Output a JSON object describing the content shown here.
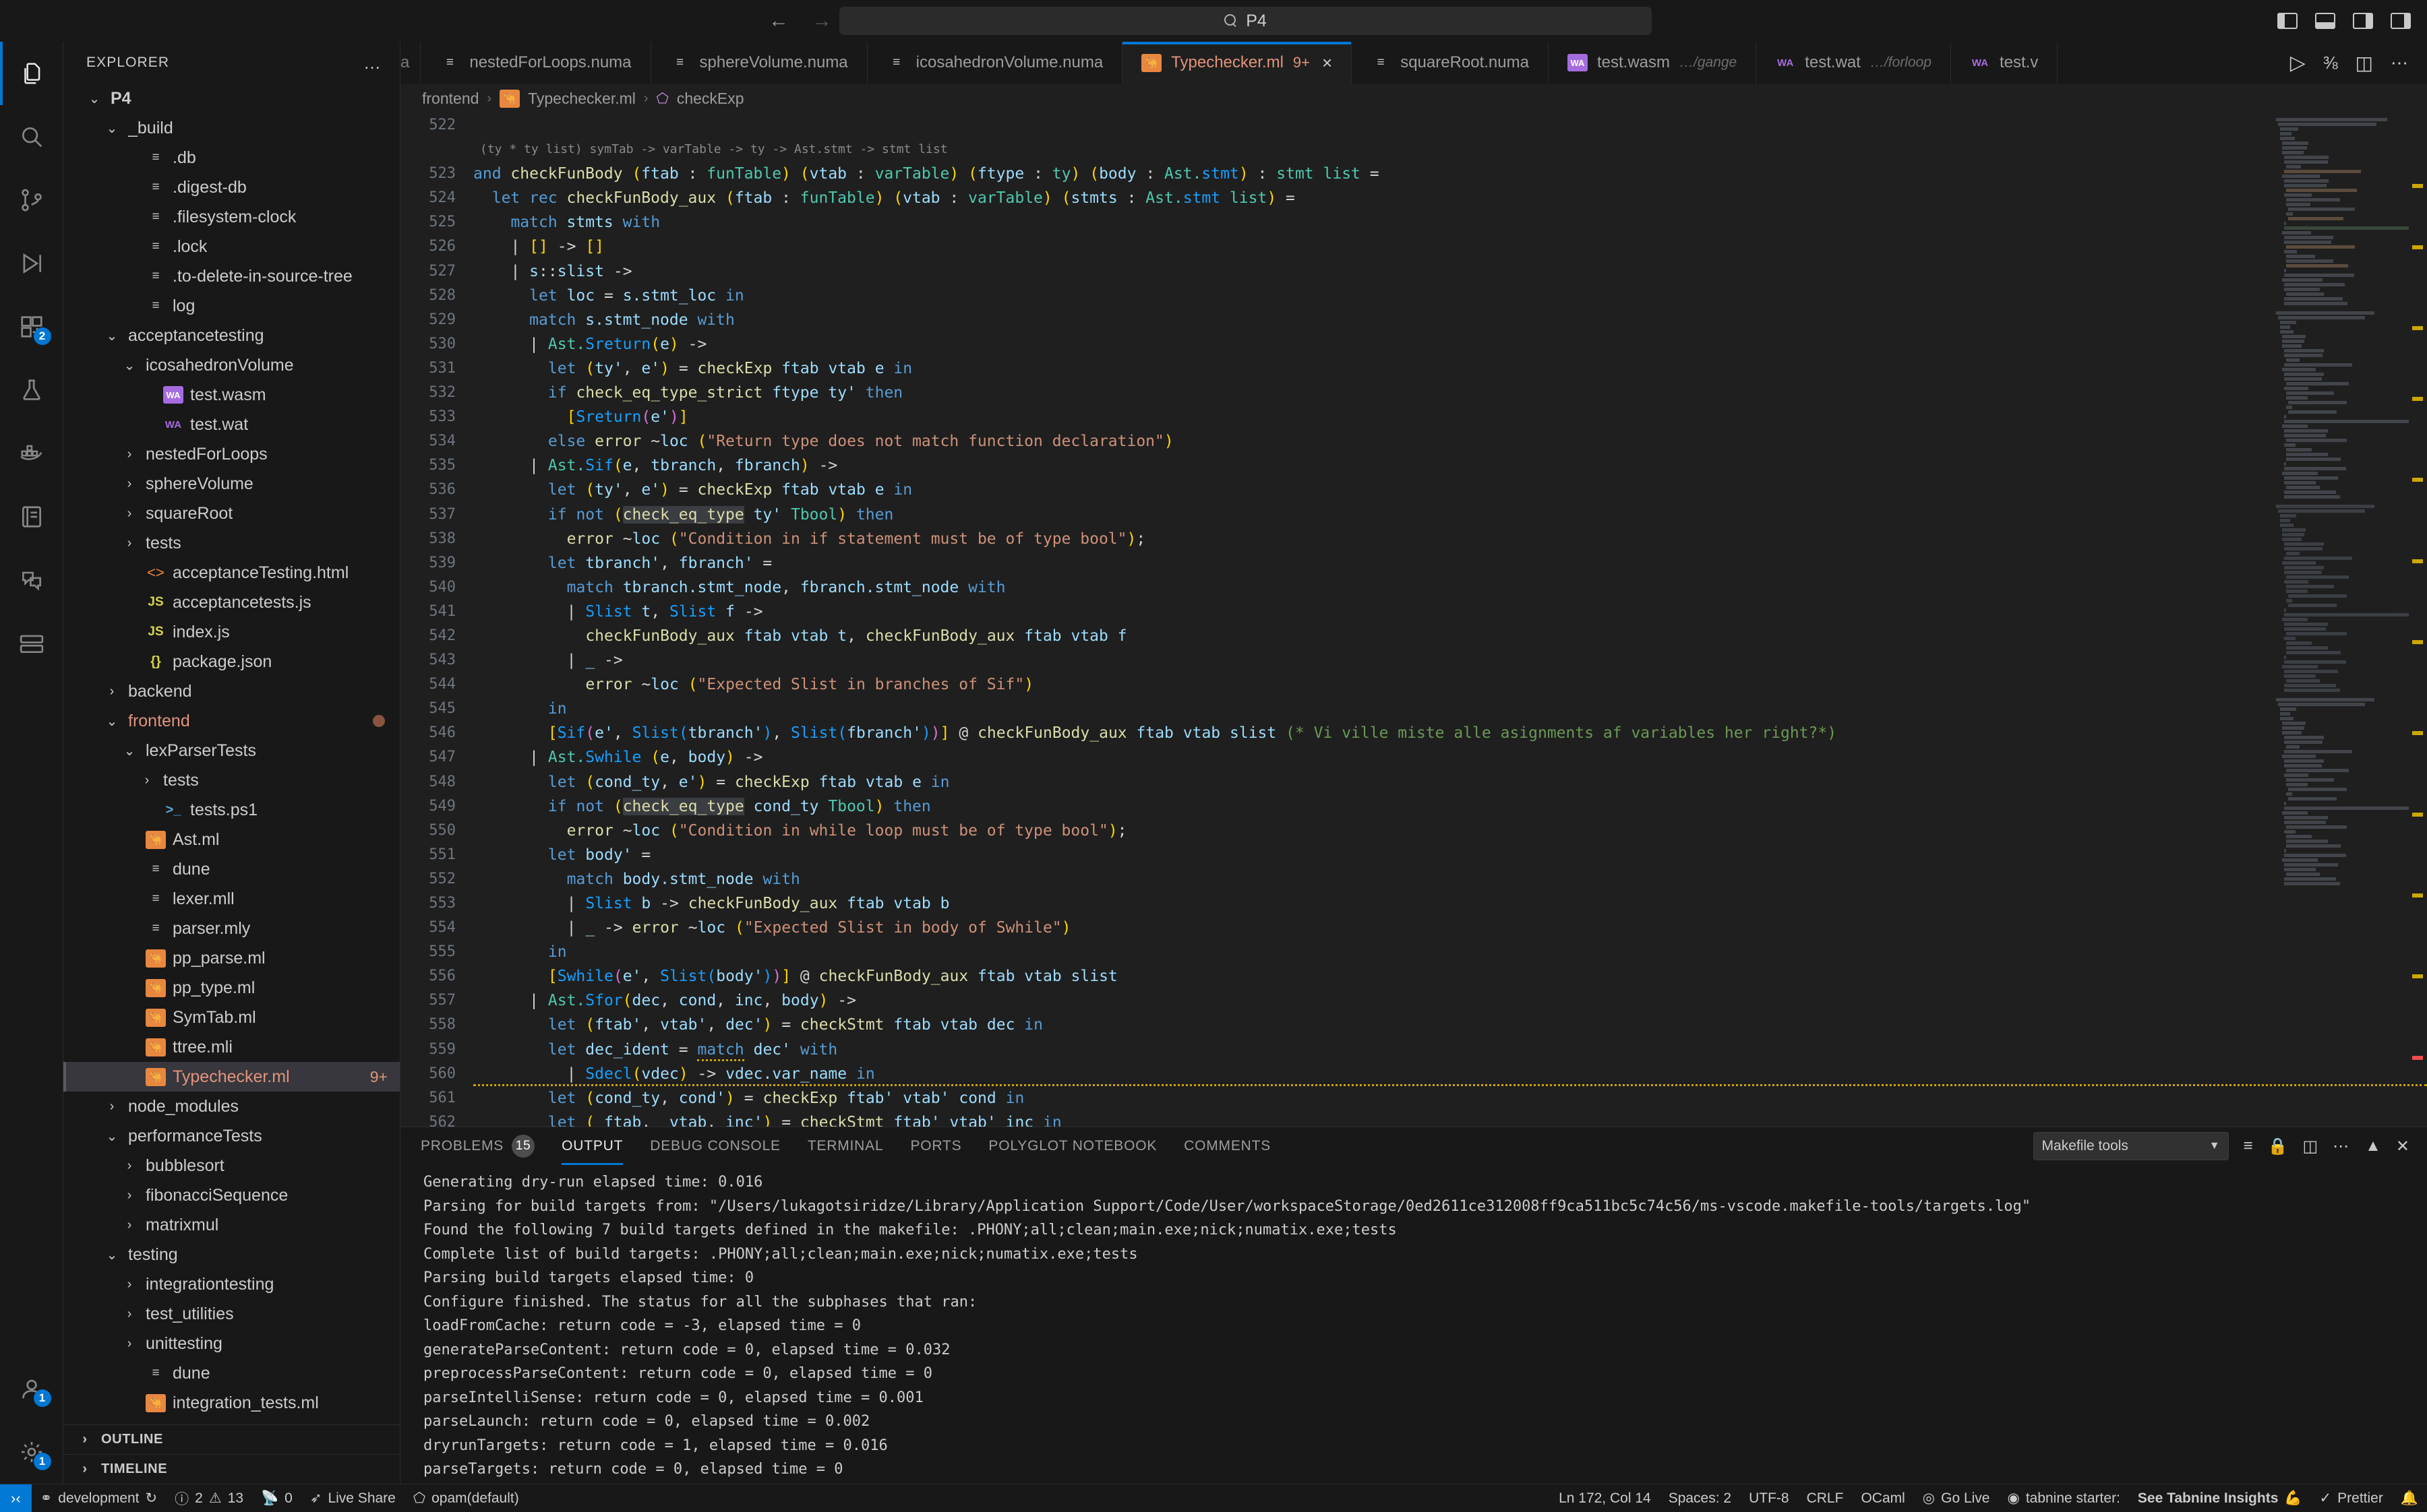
{
  "titlebar": {
    "search_text": "P4",
    "search_icon": "search-icon",
    "back_icon": "back-arrow-icon",
    "forward_icon": "forward-arrow-icon",
    "layout_left_icon": "toggle-primary-sidebar-icon",
    "layout_bottom_icon": "toggle-panel-icon",
    "layout_right_icon": "toggle-secondary-sidebar-icon",
    "layout_custom_icon": "customize-layout-icon"
  },
  "activitybar": {
    "items": [
      {
        "name": "explorer",
        "icon": "files-icon",
        "badge": "",
        "active": true
      },
      {
        "name": "search",
        "icon": "search-icon",
        "badge": "",
        "active": false
      },
      {
        "name": "source-control",
        "icon": "source-control-icon",
        "badge": "",
        "active": false
      },
      {
        "name": "run-and-debug",
        "icon": "run-debug-icon",
        "badge": "",
        "active": false
      },
      {
        "name": "extensions",
        "icon": "extensions-icon",
        "badge": "2",
        "active": false
      },
      {
        "name": "testing",
        "icon": "beaker-icon",
        "badge": "",
        "active": false
      },
      {
        "name": "docker",
        "icon": "docker-icon",
        "badge": "",
        "active": false
      },
      {
        "name": "polyglot-notebook",
        "icon": "notebook-icon",
        "badge": "",
        "active": false
      },
      {
        "name": "live-share",
        "icon": "live-share-icon",
        "badge": "",
        "active": false
      },
      {
        "name": "remote-explorer",
        "icon": "remote-explorer-icon",
        "badge": "",
        "active": false
      }
    ],
    "bottom": [
      {
        "name": "accounts",
        "icon": "account-icon",
        "badge": "1"
      },
      {
        "name": "settings",
        "icon": "gear-icon",
        "badge": "1"
      }
    ]
  },
  "sidebar": {
    "title": "EXPLORER",
    "more_actions": "…",
    "tree": [
      {
        "depth": 0,
        "label": "P4",
        "icon": "none",
        "chev": "down",
        "bold": true
      },
      {
        "depth": 1,
        "label": "_build",
        "icon": "none",
        "chev": "down"
      },
      {
        "depth": 2,
        "label": ".db",
        "icon": "file-lines"
      },
      {
        "depth": 2,
        "label": ".digest-db",
        "icon": "file-lines"
      },
      {
        "depth": 2,
        "label": ".filesystem-clock",
        "icon": "file-lines"
      },
      {
        "depth": 2,
        "label": ".lock",
        "icon": "file-lines"
      },
      {
        "depth": 2,
        "label": ".to-delete-in-source-tree",
        "icon": "file-lines"
      },
      {
        "depth": 2,
        "label": "log",
        "icon": "file-lines"
      },
      {
        "depth": 1,
        "label": "acceptancetesting",
        "icon": "none",
        "chev": "down"
      },
      {
        "depth": 2,
        "label": "icosahedronVolume",
        "icon": "none",
        "chev": "down"
      },
      {
        "depth": 3,
        "label": "test.wasm",
        "icon": "wasm-box"
      },
      {
        "depth": 3,
        "label": "test.wat",
        "icon": "wat"
      },
      {
        "depth": 2,
        "label": "nestedForLoops",
        "icon": "none",
        "chev": "right"
      },
      {
        "depth": 2,
        "label": "sphereVolume",
        "icon": "none",
        "chev": "right"
      },
      {
        "depth": 2,
        "label": "squareRoot",
        "icon": "none",
        "chev": "right"
      },
      {
        "depth": 2,
        "label": "tests",
        "icon": "none",
        "chev": "right"
      },
      {
        "depth": 2,
        "label": "acceptanceTesting.html",
        "icon": "html"
      },
      {
        "depth": 2,
        "label": "acceptancetests.js",
        "icon": "js"
      },
      {
        "depth": 2,
        "label": "index.js",
        "icon": "js"
      },
      {
        "depth": 2,
        "label": "package.json",
        "icon": "json"
      },
      {
        "depth": 1,
        "label": "backend",
        "icon": "none",
        "chev": "right"
      },
      {
        "depth": 1,
        "label": "frontend",
        "icon": "none",
        "chev": "down",
        "modified": true,
        "dot": true
      },
      {
        "depth": 2,
        "label": "lexParserTests",
        "icon": "none",
        "chev": "down"
      },
      {
        "depth": 3,
        "label": "tests",
        "icon": "none",
        "chev": "right"
      },
      {
        "depth": 3,
        "label": "tests.ps1",
        "icon": "ps1"
      },
      {
        "depth": 2,
        "label": "Ast.ml",
        "icon": "ocaml"
      },
      {
        "depth": 2,
        "label": "dune",
        "icon": "file-lines"
      },
      {
        "depth": 2,
        "label": "lexer.mll",
        "icon": "file-lines"
      },
      {
        "depth": 2,
        "label": "parser.mly",
        "icon": "file-lines"
      },
      {
        "depth": 2,
        "label": "pp_parse.ml",
        "icon": "ocaml"
      },
      {
        "depth": 2,
        "label": "pp_type.ml",
        "icon": "ocaml"
      },
      {
        "depth": 2,
        "label": "SymTab.ml",
        "icon": "ocaml"
      },
      {
        "depth": 2,
        "label": "ttree.mli",
        "icon": "ocaml"
      },
      {
        "depth": 2,
        "label": "Typechecker.ml",
        "icon": "ocaml",
        "selected": true,
        "modified": true,
        "badge": "9+"
      },
      {
        "depth": 1,
        "label": "node_modules",
        "icon": "none",
        "chev": "right"
      },
      {
        "depth": 1,
        "label": "performanceTests",
        "icon": "none",
        "chev": "down"
      },
      {
        "depth": 2,
        "label": "bubblesort",
        "icon": "none",
        "chev": "right"
      },
      {
        "depth": 2,
        "label": "fibonacciSequence",
        "icon": "none",
        "chev": "right"
      },
      {
        "depth": 2,
        "label": "matrixmul",
        "icon": "none",
        "chev": "right"
      },
      {
        "depth": 1,
        "label": "testing",
        "icon": "none",
        "chev": "down"
      },
      {
        "depth": 2,
        "label": "integrationtesting",
        "icon": "none",
        "chev": "right"
      },
      {
        "depth": 2,
        "label": "test_utilities",
        "icon": "none",
        "chev": "right"
      },
      {
        "depth": 2,
        "label": "unittesting",
        "icon": "none",
        "chev": "right"
      },
      {
        "depth": 2,
        "label": "dune",
        "icon": "file-lines"
      },
      {
        "depth": 2,
        "label": "integration_tests.ml",
        "icon": "ocaml"
      }
    ],
    "sections": [
      {
        "label": "OUTLINE",
        "chev": "right"
      },
      {
        "label": "TIMELINE",
        "chev": "right"
      }
    ]
  },
  "tabs": [
    {
      "label": "a",
      "icon": "file-lines",
      "partial": true,
      "active": false
    },
    {
      "label": "nestedForLoops.numa",
      "icon": "file-lines",
      "active": false
    },
    {
      "label": "sphereVolume.numa",
      "icon": "file-lines",
      "active": false
    },
    {
      "label": "icosahedronVolume.numa",
      "icon": "file-lines",
      "active": false
    },
    {
      "label": "Typechecker.ml",
      "icon": "ocaml",
      "count": "9+",
      "active": true,
      "close": "×"
    },
    {
      "label": "squareRoot.numa",
      "icon": "file-lines",
      "active": false
    },
    {
      "label": "test.wasm",
      "icon": "wasm-box",
      "suffix": "…/gange",
      "active": false
    },
    {
      "label": "test.wat",
      "icon": "wat",
      "suffix": "…/forloop",
      "active": false
    },
    {
      "label": "test.v",
      "icon": "wat",
      "active": false
    }
  ],
  "tab_actions": {
    "run_icon": "run-play-icon",
    "split_icon": "split-editor-icon",
    "more_icon": "more-actions-icon",
    "graph_icon": "show-changes-icon"
  },
  "breadcrumb": {
    "parts": [
      "frontend",
      "Typechecker.ml",
      "checkExp"
    ],
    "separator": "›",
    "file_icon": "ocaml-icon",
    "symbol_icon": "symbol-function-icon"
  },
  "editor": {
    "first_line": 522,
    "codelens": "(ty * ty list) symTab -> varTable -> ty -> Ast.stmt -> stmt list",
    "lines": [
      {
        "n": 522,
        "text": ""
      },
      {
        "n": "lens"
      },
      {
        "n": 523,
        "text": "and checkFunBody (ftab : funTable) (vtab : varTable) (ftype : ty) (body : Ast.stmt) : stmt list ="
      },
      {
        "n": 524,
        "text": "  let rec checkFunBody_aux (ftab : funTable) (vtab : varTable) (stmts : Ast.stmt list) ="
      },
      {
        "n": 525,
        "text": "    match stmts with"
      },
      {
        "n": 526,
        "text": "    | [] -> []"
      },
      {
        "n": 527,
        "text": "    | s::slist ->"
      },
      {
        "n": 528,
        "text": "      let loc = s.stmt_loc in"
      },
      {
        "n": 529,
        "text": "      match s.stmt_node with"
      },
      {
        "n": 530,
        "text": "      | Ast.Sreturn(e) ->"
      },
      {
        "n": 531,
        "text": "        let (ty', e') = checkExp ftab vtab e in"
      },
      {
        "n": 532,
        "text": "        if check_eq_type_strict ftype ty' then"
      },
      {
        "n": 533,
        "text": "          [Sreturn(e')]"
      },
      {
        "n": 534,
        "text": "        else error ~loc (\"Return type does not match function declaration\")"
      },
      {
        "n": 535,
        "text": "      | Ast.Sif(e, tbranch, fbranch) ->"
      },
      {
        "n": 536,
        "text": "        let (ty', e') = checkExp ftab vtab e in"
      },
      {
        "n": 537,
        "text": "        if not (check_eq_type ty' Tbool) then"
      },
      {
        "n": 538,
        "text": "          error ~loc (\"Condition in if statement must be of type bool\");"
      },
      {
        "n": 539,
        "text": "        let tbranch', fbranch' ="
      },
      {
        "n": 540,
        "text": "          match tbranch.stmt_node, fbranch.stmt_node with"
      },
      {
        "n": 541,
        "text": "          | Slist t, Slist f ->"
      },
      {
        "n": 542,
        "text": "            checkFunBody_aux ftab vtab t, checkFunBody_aux ftab vtab f"
      },
      {
        "n": 543,
        "text": "          | _ ->"
      },
      {
        "n": 544,
        "text": "            error ~loc (\"Expected Slist in branches of Sif\")"
      },
      {
        "n": 545,
        "text": "        in"
      },
      {
        "n": 546,
        "text": "        [Sif(e', Slist(tbranch'), Slist(fbranch'))] @ checkFunBody_aux ftab vtab slist (* Vi ville miste alle asignments af variables her right?*)"
      },
      {
        "n": 547,
        "text": "      | Ast.Swhile (e, body) ->"
      },
      {
        "n": 548,
        "text": "        let (cond_ty, e') = checkExp ftab vtab e in"
      },
      {
        "n": 549,
        "text": "        if not (check_eq_type cond_ty Tbool) then"
      },
      {
        "n": 550,
        "text": "          error ~loc (\"Condition in while loop must be of type bool\");"
      },
      {
        "n": 551,
        "text": "        let body' ="
      },
      {
        "n": 552,
        "text": "          match body.stmt_node with"
      },
      {
        "n": 553,
        "text": "          | Slist b -> checkFunBody_aux ftab vtab b"
      },
      {
        "n": 554,
        "text": "          | _ -> error ~loc (\"Expected Slist in body of Swhile\")"
      },
      {
        "n": 555,
        "text": "        in"
      },
      {
        "n": 556,
        "text": "        [Swhile(e', Slist(body'))] @ checkFunBody_aux ftab vtab slist"
      },
      {
        "n": 557,
        "text": "      | Ast.Sfor(dec, cond, inc, body) ->"
      },
      {
        "n": 558,
        "text": "        let (ftab', vtab', dec') = checkStmt ftab vtab dec in"
      },
      {
        "n": 559,
        "text": "        let dec_ident = match dec' with"
      },
      {
        "n": 560,
        "text": "          | Sdecl(vdec) -> vdec.var_name in"
      },
      {
        "n": 561,
        "text": "        let (cond_ty, cond') = checkExp ftab' vtab' cond in"
      },
      {
        "n": 562,
        "text": "        let (_ftab, _vtab, inc') = checkStmt ftab' vtab' inc in"
      }
    ]
  },
  "panel": {
    "tabs": [
      {
        "label": "PROBLEMS",
        "badge": "15",
        "active": false
      },
      {
        "label": "OUTPUT",
        "badge": "",
        "active": true
      },
      {
        "label": "DEBUG CONSOLE",
        "badge": "",
        "active": false
      },
      {
        "label": "TERMINAL",
        "badge": "",
        "active": false
      },
      {
        "label": "PORTS",
        "badge": "",
        "active": false
      },
      {
        "label": "POLYGLOT NOTEBOOK",
        "badge": "",
        "active": false
      },
      {
        "label": "COMMENTS",
        "badge": "",
        "active": false
      }
    ],
    "output_source": "Makefile tools",
    "actions": {
      "clear_icon": "clear-output-icon",
      "lock_icon": "lock-scroll-icon",
      "split_icon": "split-panel-icon",
      "more_icon": "more-actions-icon",
      "maximize_icon": "maximize-panel-icon",
      "close_icon": "close-panel-icon"
    },
    "output_lines": [
      "Generating dry-run elapsed time: 0.016",
      "Parsing for build targets from: \"/Users/lukagotsiridze/Library/Application Support/Code/User/workspaceStorage/0ed2611ce312008ff9ca511bc5c74c56/ms-vscode.makefile-tools/targets.log\"",
      "Found the following 7 build targets defined in the makefile: .PHONY;all;clean;main.exe;nick;numatix.exe;tests",
      "Complete list of build targets: .PHONY;all;clean;main.exe;nick;numatix.exe;tests",
      "Parsing build targets elapsed time: 0",
      "Configure finished. The status for all the subphases that ran:",
      "loadFromCache: return code = -3, elapsed time = 0",
      "generateParseContent: return code = 0, elapsed time = 0.032",
      "preprocessParseContent: return code = 0, elapsed time = 0",
      "parseIntelliSense: return code = 0, elapsed time = 0.001",
      "parseLaunch: return code = 0, elapsed time = 0.002",
      "dryrunTargets: return code = 1, elapsed time = 0.016",
      "parseTargets: return code = 0, elapsed time = 0"
    ]
  },
  "statusbar": {
    "remote_label": "",
    "remote_icon": "remote-window-icon",
    "left": [
      {
        "icon": "source-control-branch-icon",
        "label": "development",
        "extra_icon": "sync-icon"
      },
      {
        "icon": "error-icon",
        "label": "2",
        "icon2": "warning-icon",
        "label2": "13"
      },
      {
        "icon": "radio-tower-icon",
        "label": "0"
      },
      {
        "icon": "live-share-icon",
        "label": "Live Share"
      },
      {
        "icon": "package-icon",
        "label": "opam(default)"
      }
    ],
    "right": [
      {
        "label": "Ln 172, Col 14"
      },
      {
        "label": "Spaces: 2"
      },
      {
        "label": "UTF-8"
      },
      {
        "label": "CRLF"
      },
      {
        "label": "OCaml"
      },
      {
        "icon": "broadcast-icon",
        "label": "Go Live"
      },
      {
        "icon": "tabnine-icon",
        "label": "tabnine starter:"
      },
      {
        "label": "See Tabnine Insights",
        "strong": true,
        "emoji": "💪"
      },
      {
        "icon": "prettier-check-icon",
        "label": "Prettier"
      },
      {
        "icon": "bell-icon",
        "label": ""
      }
    ]
  },
  "colors": {
    "accent": "#0078d4",
    "modified": "#e2937b",
    "editor_bg": "#1f1f1f",
    "chrome_bg": "#181818",
    "warning": "#cca700"
  }
}
